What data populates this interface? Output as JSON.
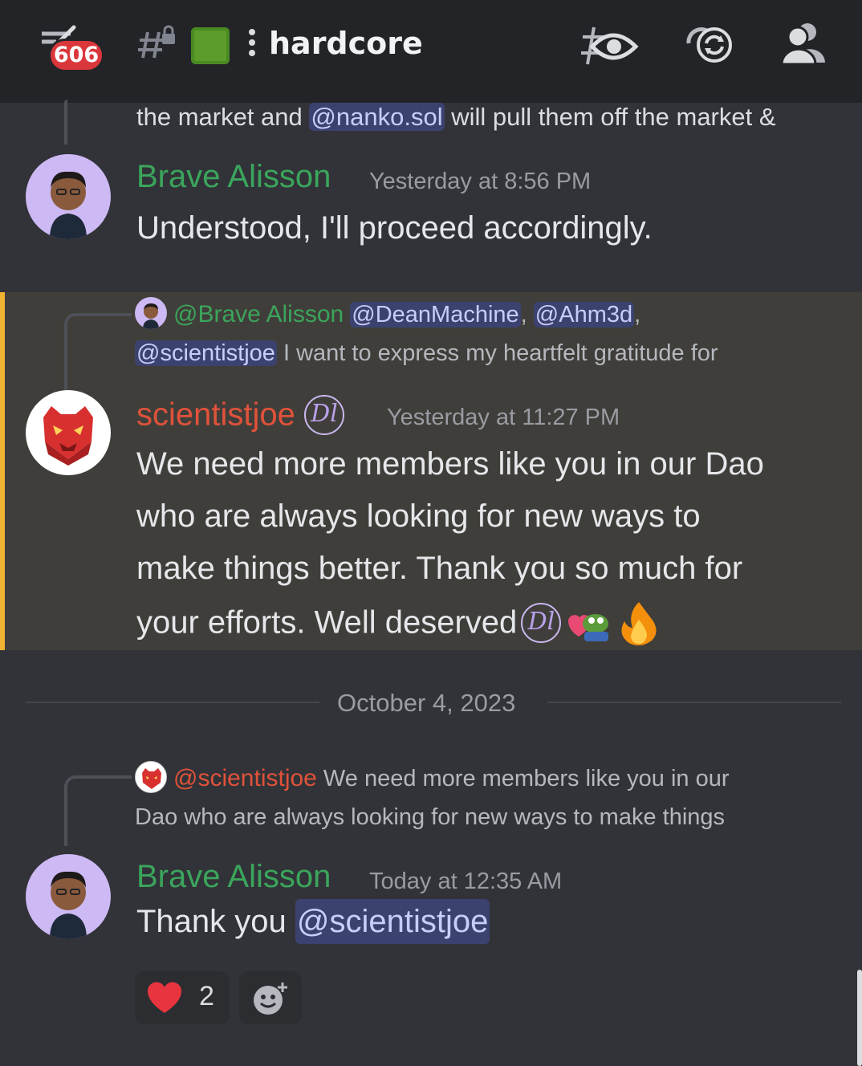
{
  "header": {
    "back_badge": "606",
    "channel_name": "hardcore",
    "icons": [
      "back-arrow-icon",
      "hash-lock-icon",
      "green-square-emoji",
      "watch-eye-icon",
      "threads-icon",
      "members-icon"
    ]
  },
  "messages": {
    "top_cut": {
      "pre": "the market and ",
      "mention": "@nanko.sol",
      "post": " will pull them off the market &"
    },
    "msg1": {
      "username": "Brave Alisson",
      "timestamp": "Yesterday at 8:56 PM",
      "text": "Understood, I'll proceed accordingly."
    },
    "msg2": {
      "reply_user": "@Brave Alisson",
      "reply_mention1": "@DeanMachine",
      "reply_sep1": ",",
      "reply_mention2": "@Ahm3d",
      "reply_sep2": ",",
      "reply_mention3": "@scientistjoe",
      "reply_text": " I want to express my heartfelt gratitude for",
      "username": "scientistjoe",
      "badge": "Dl",
      "timestamp": "Yesterday at 11:27 PM",
      "line1": "We need more members like you in our Dao",
      "line2": "who are always looking for new ways to",
      "line3": "make things better. Thank you so much for",
      "line4": "your efforts.  Well deserved",
      "emojis": [
        "dl-badge-emoji",
        "pepe-heart-emoji",
        "fire-emoji"
      ]
    },
    "divider_date": "October 4, 2023",
    "msg3": {
      "reply_user": "@scientistjoe",
      "reply_line1": " We need more members like you in our",
      "reply_line2": "Dao who are always looking for new ways to make things",
      "username": "Brave Alisson",
      "timestamp": "Today at 12:35 AM",
      "text": "Thank you ",
      "mention": "@scientistjoe",
      "reaction_count": "2"
    }
  },
  "colors": {
    "background": "#313338",
    "header": "#232428",
    "highlight": "#403e3a",
    "highlight_bar": "#f0b232",
    "green_name": "#3ba55c",
    "red_name": "#e0523a",
    "mention_bg": "#3c4270",
    "badge_red": "#da373c"
  }
}
